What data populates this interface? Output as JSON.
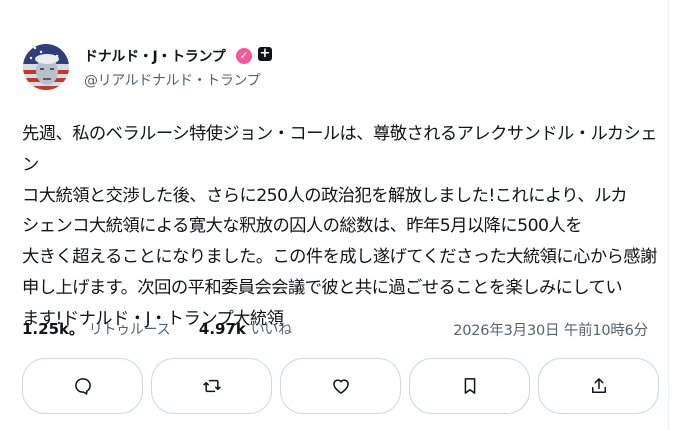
{
  "author": {
    "name": "ドナルド・J・トランプ",
    "handle": "@リアルドナルド・トランプ",
    "verified_mark": "✓",
    "plus_mark": "+"
  },
  "post": {
    "text": "先週、私のベラルーシ特使ジョン・コールは、尊敬されるアレクサンドル・ルカシェン\nコ大統領と交渉した後、さらに250人の政治犯を解放しました!これにより、ルカ\nシェンコ大統領による寛大な釈放の囚人の総数は、昨年5月以降に500人を\n大きく超えることになりました。この件を成し遂げてくださった大統領に心から感謝\n申し上げます。次回の平和委員会会議で彼と共に過ごせることを楽しみにしてい\nます!ドナルド・J・トランプ大統領"
  },
  "stats": {
    "reposts_count": "1.25k",
    "reposts_sep": "。",
    "reposts_label": "リトゥルース",
    "likes_count": "4.97k",
    "likes_label": "いいね",
    "timestamp": "2026年3月30日 午前10時6分"
  },
  "actions": [
    {
      "icon": "reply-icon"
    },
    {
      "icon": "repost-icon"
    },
    {
      "icon": "heart-icon"
    },
    {
      "icon": "bookmark-icon"
    },
    {
      "icon": "share-icon"
    }
  ],
  "colors": {
    "verified": "#f4589a",
    "secondary_text": "#536471",
    "border": "#cfd9de"
  }
}
